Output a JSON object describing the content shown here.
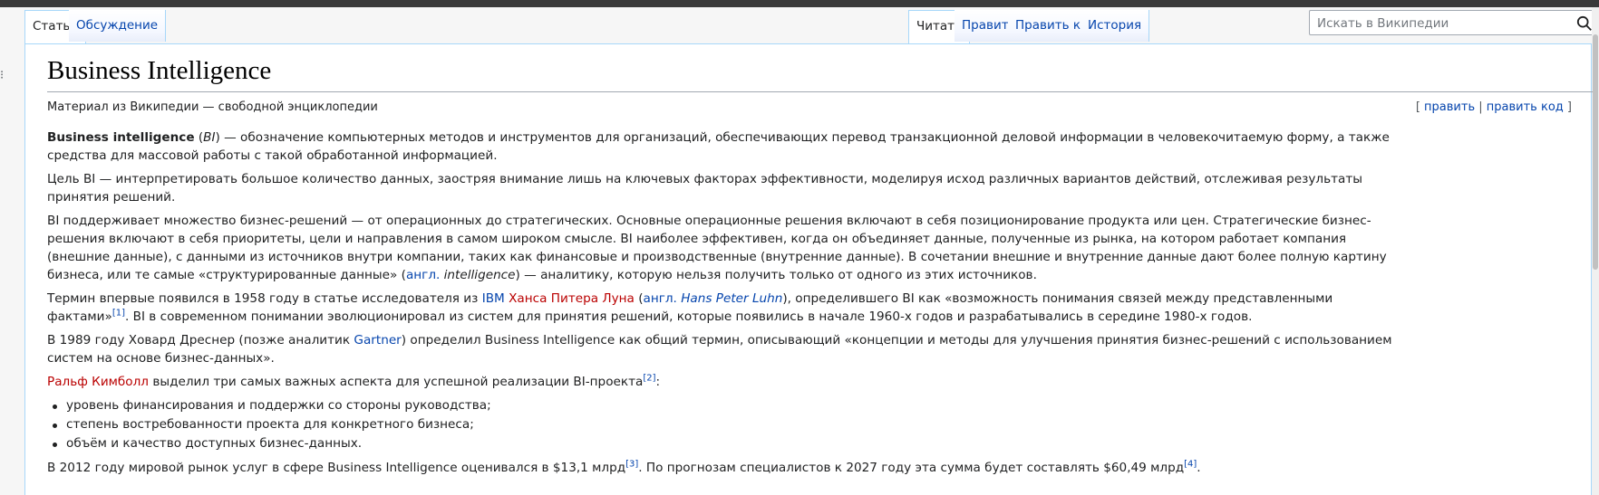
{
  "tabs_left": [
    {
      "label": "Статья"
    },
    {
      "label": "Обсуждение"
    }
  ],
  "tabs_right": [
    {
      "label": "Читать"
    },
    {
      "label": "Править"
    },
    {
      "label": "Править код"
    },
    {
      "label": "История"
    }
  ],
  "search": {
    "placeholder": "Искать в Википедии",
    "icon": "search-icon"
  },
  "page": {
    "title": "Business Intelligence",
    "subtitle": "Материал из Википедии — свободной энциклопедии",
    "edit": {
      "open": "[",
      "edit": "править",
      "sep": "|",
      "edit_code": "править код",
      "close": "]"
    }
  },
  "para1": {
    "bold": "Business intelligence",
    "t1": " (",
    "italic": "BI",
    "t2": ") — обозначение компьютерных методов и инструментов для организаций, обеспечивающих перевод транзакционной деловой информации в человекочитаемую форму, а также средства для массовой работы с такой обработанной информацией."
  },
  "para2": "Цель BI — интерпретировать большое количество данных, заостряя внимание лишь на ключевых факторах эффективности, моделируя исход различных вариантов действий, отслеживая результаты принятия решений.",
  "para3": {
    "t1": "BI поддерживает множество бизнес-решений — от операционных до стратегических. Основные операционные решения включают в себя позиционирование продукта или цен. Стратегические бизнес-решения включают в себя приоритеты, цели и направления в самом широком смысле. BI наиболее эффективен, когда он объединяет данные, полученные из рынка, на котором работает компания (внешние данные), с данными из источников внутри компании, таких как финансовые и производственные (внутренние данные). В сочетании внешние и внутренние данные дают более полную картину бизнеса, или те самые «структурированные данные» (",
    "lang": "англ.",
    "term": "intelligence",
    "t2": ") — аналитику, которую нельзя получить только от одного из этих источников."
  },
  "para4": {
    "t1": "Термин впервые появился в 1958 году в статье исследователя из ",
    "ibm": "IBM",
    "name": "Ханса Питера Луна",
    "t2": " (",
    "lang": "англ.",
    "orig": "Hans Peter Luhn",
    "t3": "), определившего BI как «возможность понимания связей между представленными фактами»",
    "ref": "[1]",
    "t4": ". BI в современном понимании эволюционировал из систем для принятия решений, которые появились в начале 1960-х годов и разрабатывались в середине 1980-х годов."
  },
  "para5": {
    "t1": "В 1989 году Ховард Дреснер (позже аналитик ",
    "gartner": "Gartner",
    "t2": ") определил Business Intelligence как общий термин, описывающий «концепции и методы для улучшения принятия бизнес-решений с использованием систем на основе бизнес-данных»."
  },
  "para6": {
    "name": "Ральф Кимболл",
    "t1": " выделил три самых важных аспекта для успешной реализации BI-проекта",
    "ref": "[2]",
    "t2": ":"
  },
  "list": [
    {
      "text": "уровень финансирования и поддержки со стороны руководства;"
    },
    {
      "text": "степень востребованности проекта для конкретного бизнеса;"
    },
    {
      "text": "объём и качество доступных бизнес-данных."
    }
  ],
  "para7": {
    "t1": "В 2012 году мировой рынок услуг в сфере Business Intelligence оценивался в $13,1 млрд",
    "ref1": "[3]",
    "t2": ". По прогнозам специалистов к 2027 году эта сумма будет составлять $60,49 млрд",
    "ref2": "[4]",
    "t3": "."
  },
  "colors": {
    "link": "#0645ad",
    "redlink": "#ba0000",
    "tab_border": "#a7d7f9",
    "text": "#202122"
  }
}
